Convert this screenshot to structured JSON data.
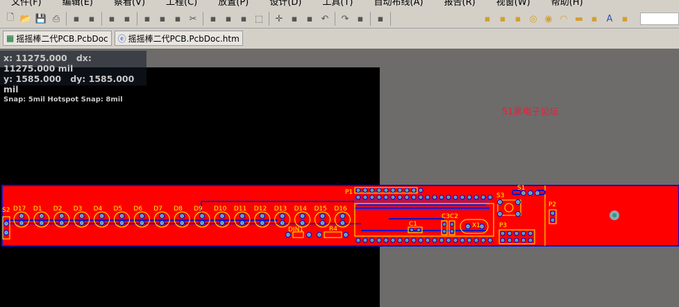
{
  "menu": [
    "文件(F)",
    "编辑(E)",
    "察看(V)",
    "工程(C)",
    "放置(P)",
    "设计(D)",
    "工具(T)",
    "自动布线(A)",
    "报告(R)",
    "视窗(W)",
    "帮助(H)"
  ],
  "toolbar_icons": [
    "new-file-icon",
    "open-folder-icon",
    "save-icon",
    "print-icon",
    "print-preview-icon",
    "layers-icon",
    "board-icon",
    "zoom-fit-icon",
    "zoom-area-icon",
    "zoom-selected-icon",
    "zoom-filter-icon",
    "cut-icon",
    "copy-icon",
    "paste-icon",
    "rubber-stamp-icon",
    "select-area-icon",
    "move-icon",
    "deselect-icon",
    "clear-filter-icon",
    "undo-icon",
    "redo-icon",
    "wand-icon",
    "browse-icon",
    "interactive-route-icon",
    "route-diff-icon",
    "route-multi-icon",
    "via-icon",
    "pad-icon",
    "arc-icon",
    "fill-icon",
    "polygon-icon",
    "string-icon",
    "component-icon"
  ],
  "tabs": [
    {
      "label": "摇摇棒二代PCB.PcbDoc",
      "icon": "pcb-doc-icon"
    },
    {
      "label": "摇摇棒二代PCB.PcbDoc.htm",
      "icon": "html-doc-icon"
    }
  ],
  "coords": {
    "x": "x: 11275.000",
    "dx": "dx: 11275.000  mil",
    "y": "y:  1585.000",
    "dy": "dy:  1585.000  mil",
    "snap": "Snap: 5mil Hotspot Snap: 8mil"
  },
  "watermark": "51黑电子论坛",
  "colors": {
    "board": "#ff0000",
    "bottom_trace": "#1010c8",
    "silkscreen": "#ffff00",
    "pad": "#8fa8b0",
    "background": "#000000",
    "workspace": "#6e6b6b"
  },
  "pcb": {
    "leds": [
      "D17",
      "D1",
      "D2",
      "D3",
      "D4",
      "D5",
      "D6",
      "D7",
      "D8",
      "D9",
      "D10",
      "D11",
      "D12",
      "D13",
      "D14",
      "D15",
      "D16"
    ],
    "labels": {
      "s2": "S2",
      "din1": "DIN1",
      "r4": "R4",
      "p1": "P1",
      "c1": "C1",
      "c3c2": "C3C2",
      "x1": "X1",
      "s3": "S3",
      "s1": "S1",
      "p3": "P3",
      "p2": "P2"
    }
  }
}
